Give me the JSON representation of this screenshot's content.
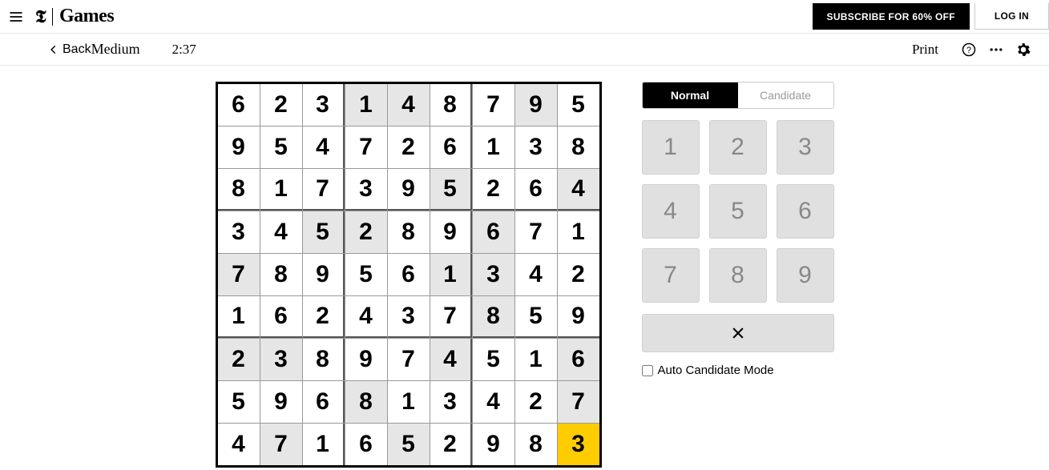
{
  "header": {
    "logo_t_glyph": "𝕿",
    "logo_text": "Games",
    "subscribe_label": "SUBSCRIBE FOR 60% OFF",
    "login_label": "LOG IN"
  },
  "subheader": {
    "back_label": "Back",
    "difficulty": "Medium",
    "timer": "2:37",
    "print_label": "Print"
  },
  "board": {
    "rows": [
      [
        {
          "v": "6",
          "g": false
        },
        {
          "v": "2",
          "g": false
        },
        {
          "v": "3",
          "g": false
        },
        {
          "v": "1",
          "g": true
        },
        {
          "v": "4",
          "g": true
        },
        {
          "v": "8",
          "g": false
        },
        {
          "v": "7",
          "g": false
        },
        {
          "v": "9",
          "g": true
        },
        {
          "v": "5",
          "g": false
        }
      ],
      [
        {
          "v": "9",
          "g": false
        },
        {
          "v": "5",
          "g": false
        },
        {
          "v": "4",
          "g": false
        },
        {
          "v": "7",
          "g": false
        },
        {
          "v": "2",
          "g": false
        },
        {
          "v": "6",
          "g": false
        },
        {
          "v": "1",
          "g": false
        },
        {
          "v": "3",
          "g": false
        },
        {
          "v": "8",
          "g": false
        }
      ],
      [
        {
          "v": "8",
          "g": false
        },
        {
          "v": "1",
          "g": false
        },
        {
          "v": "7",
          "g": false
        },
        {
          "v": "3",
          "g": false
        },
        {
          "v": "9",
          "g": false
        },
        {
          "v": "5",
          "g": true
        },
        {
          "v": "2",
          "g": false
        },
        {
          "v": "6",
          "g": false
        },
        {
          "v": "4",
          "g": true
        }
      ],
      [
        {
          "v": "3",
          "g": false
        },
        {
          "v": "4",
          "g": false
        },
        {
          "v": "5",
          "g": true
        },
        {
          "v": "2",
          "g": true
        },
        {
          "v": "8",
          "g": false
        },
        {
          "v": "9",
          "g": false
        },
        {
          "v": "6",
          "g": true
        },
        {
          "v": "7",
          "g": false
        },
        {
          "v": "1",
          "g": false
        }
      ],
      [
        {
          "v": "7",
          "g": true
        },
        {
          "v": "8",
          "g": false
        },
        {
          "v": "9",
          "g": false
        },
        {
          "v": "5",
          "g": false
        },
        {
          "v": "6",
          "g": false
        },
        {
          "v": "1",
          "g": true
        },
        {
          "v": "3",
          "g": true
        },
        {
          "v": "4",
          "g": false
        },
        {
          "v": "2",
          "g": false
        }
      ],
      [
        {
          "v": "1",
          "g": false
        },
        {
          "v": "6",
          "g": false
        },
        {
          "v": "2",
          "g": false
        },
        {
          "v": "4",
          "g": false
        },
        {
          "v": "3",
          "g": false
        },
        {
          "v": "7",
          "g": false
        },
        {
          "v": "8",
          "g": true
        },
        {
          "v": "5",
          "g": false
        },
        {
          "v": "9",
          "g": false
        }
      ],
      [
        {
          "v": "2",
          "g": true
        },
        {
          "v": "3",
          "g": true
        },
        {
          "v": "8",
          "g": false
        },
        {
          "v": "9",
          "g": false
        },
        {
          "v": "7",
          "g": false
        },
        {
          "v": "4",
          "g": true
        },
        {
          "v": "5",
          "g": false
        },
        {
          "v": "1",
          "g": false
        },
        {
          "v": "6",
          "g": true
        }
      ],
      [
        {
          "v": "5",
          "g": false
        },
        {
          "v": "9",
          "g": false
        },
        {
          "v": "6",
          "g": false
        },
        {
          "v": "8",
          "g": true
        },
        {
          "v": "1",
          "g": false
        },
        {
          "v": "3",
          "g": false
        },
        {
          "v": "4",
          "g": false
        },
        {
          "v": "2",
          "g": false
        },
        {
          "v": "7",
          "g": true
        }
      ],
      [
        {
          "v": "4",
          "g": false
        },
        {
          "v": "7",
          "g": true
        },
        {
          "v": "1",
          "g": false
        },
        {
          "v": "6",
          "g": false
        },
        {
          "v": "5",
          "g": true
        },
        {
          "v": "2",
          "g": false
        },
        {
          "v": "9",
          "g": false
        },
        {
          "v": "8",
          "g": false
        },
        {
          "v": "3",
          "g": false,
          "sel": true
        }
      ]
    ]
  },
  "side": {
    "mode_normal": "Normal",
    "mode_candidate": "Candidate",
    "keys": [
      "1",
      "2",
      "3",
      "4",
      "5",
      "6",
      "7",
      "8",
      "9"
    ],
    "auto_candidate_label": "Auto Candidate Mode",
    "auto_candidate_checked": false
  }
}
